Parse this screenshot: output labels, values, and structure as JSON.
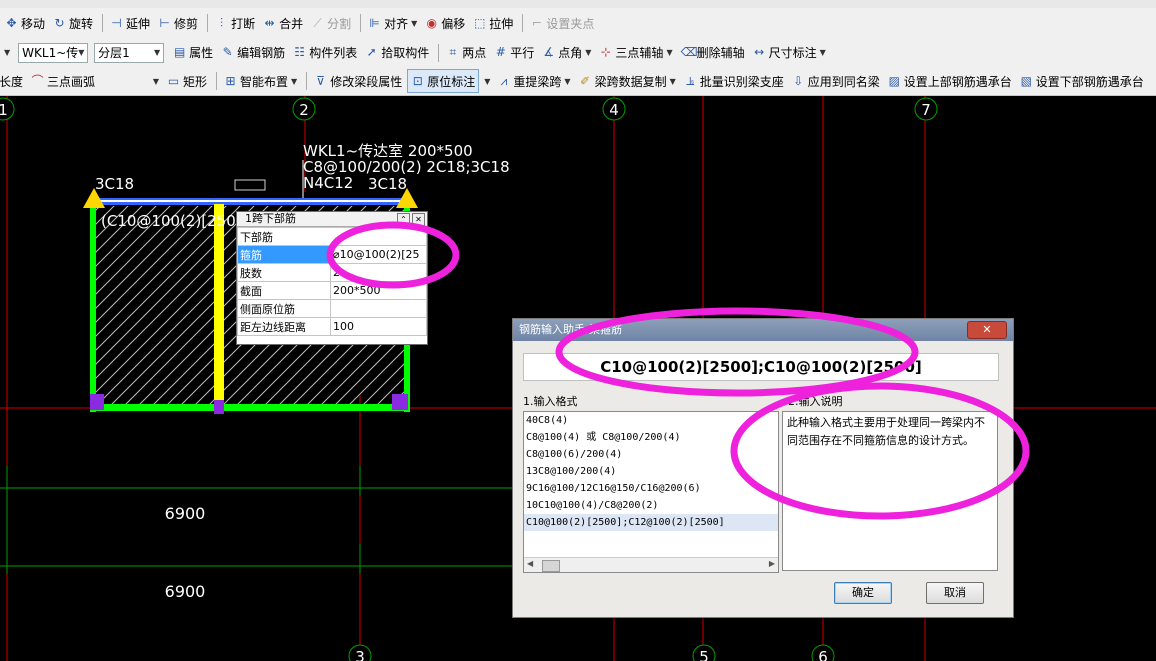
{
  "toolbar1": {
    "items": [
      {
        "label": "移动",
        "icon": "move-icon"
      },
      {
        "label": "旋转",
        "icon": "rotate-icon"
      },
      {
        "label": "延伸",
        "icon": "extend-icon"
      },
      {
        "label": "修剪",
        "icon": "trim-icon"
      },
      {
        "label": "打断",
        "icon": "break-icon"
      },
      {
        "label": "合并",
        "icon": "merge-icon"
      },
      {
        "label": "分割",
        "icon": "split-icon"
      },
      {
        "label": "对齐",
        "icon": "align-icon"
      },
      {
        "label": "偏移",
        "icon": "offset-icon"
      },
      {
        "label": "拉伸",
        "icon": "stretch-icon"
      },
      {
        "label": "设置夹点",
        "icon": "grip-icon"
      }
    ]
  },
  "toolbar2": {
    "component_select": "WKL1~传",
    "floor_select": "分层1",
    "items": [
      {
        "label": "属性",
        "icon": "properties-icon"
      },
      {
        "label": "编辑钢筋",
        "icon": "edit-rebar-icon"
      },
      {
        "label": "构件列表",
        "icon": "component-list-icon"
      },
      {
        "label": "拾取构件",
        "icon": "pick-icon"
      },
      {
        "label": "两点",
        "icon": "two-point-icon"
      },
      {
        "label": "平行",
        "icon": "parallel-icon"
      },
      {
        "label": "点角",
        "icon": "point-angle-icon"
      },
      {
        "label": "三点辅轴",
        "icon": "three-point-axis-icon"
      },
      {
        "label": "删除辅轴",
        "icon": "delete-axis-icon"
      },
      {
        "label": "尺寸标注",
        "icon": "dimension-icon"
      }
    ]
  },
  "toolbar3": {
    "partial_label": "长度",
    "arc_label": "三点画弧",
    "items": [
      {
        "label": "矩形",
        "icon": "rectangle-icon"
      },
      {
        "label": "智能布置",
        "icon": "smart-layout-icon"
      },
      {
        "label": "修改梁段属性",
        "icon": "modify-segment-icon"
      },
      {
        "label": "原位标注",
        "icon": "in-situ-annotation-icon"
      },
      {
        "label": "重提梁跨",
        "icon": "re-extract-span-icon"
      },
      {
        "label": "梁跨数据复制",
        "icon": "copy-span-data-icon"
      },
      {
        "label": "批量识别梁支座",
        "icon": "batch-support-icon"
      },
      {
        "label": "应用到同名梁",
        "icon": "apply-same-name-icon"
      },
      {
        "label": "设置上部钢筋遇承台",
        "icon": "top-rebar-cap-icon"
      },
      {
        "label": "设置下部钢筋遇承台",
        "icon": "bottom-rebar-cap-icon"
      }
    ]
  },
  "canvas": {
    "axis_labels_top": [
      "1",
      "2",
      "4",
      "7"
    ],
    "axis_labels_bottom": [
      "3",
      "5",
      "6"
    ],
    "beam_annotation": [
      "WKL1~传达室 200*500",
      "C8@100/200(2) 2C18;3C18",
      "N4C12"
    ],
    "left_rebar": "3C18",
    "right_rebar": "3C18",
    "stirrup_label": "(C10@100(2)[250",
    "dimensions": [
      "6900",
      "6900"
    ],
    "colors": {
      "beam_border": "#00ff00",
      "column": "#ffff00",
      "top_bar": "#3366ff",
      "axis_line": "#d00000",
      "support_marker": "#ffd700",
      "corner": "#8a2be2",
      "dim_line": "#00a000"
    }
  },
  "property_grid": {
    "title": "1跨下部筋",
    "group": "下部筋",
    "rows": [
      {
        "key": "箍筋",
        "value": "⌀10@100(2)[25",
        "selected": true
      },
      {
        "key": "肢数",
        "value": "2"
      },
      {
        "key": "截面",
        "value": "200*500"
      },
      {
        "key": "侧面原位筋",
        "value": ""
      },
      {
        "key": "距左边线距离",
        "value": "100"
      }
    ]
  },
  "dialog": {
    "title": "钢筋输入助手-梁箍筋",
    "close_label": "✕",
    "formula": "C10@100(2)[2500];C10@100(2)[2500]",
    "format_label": "1.输入格式",
    "desc_label": "2.输入说明",
    "formats": [
      "40C8(4)",
      "C8@100(4) 或 C8@100/200(4)",
      "C8@100(6)/200(4)",
      "13C8@100/200(4)",
      "9C16@100/12C16@150/C16@200(6)",
      "10C10@100(4)/C8@200(2)",
      "C10@100(2)[2500];C12@100(2)[2500]"
    ],
    "selected_index": 6,
    "description": "此种输入格式主要用于处理同一跨梁内不同范围存在不同箍筋信息的设计方式。",
    "ok_label": "确定",
    "cancel_label": "取消"
  },
  "highlight_color": "#ee22dd"
}
